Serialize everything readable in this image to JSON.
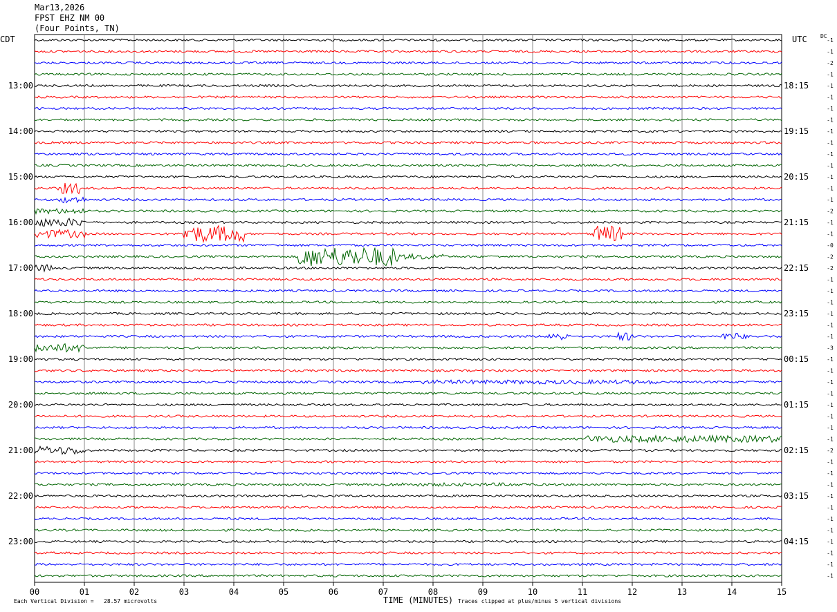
{
  "header": {
    "date": "Mar13,2026",
    "station": "FPST EHZ NM 00",
    "location": "(Four Points, TN)"
  },
  "chart_data": {
    "type": "line",
    "plot_kind": "helicorder",
    "left_timezone": "CDT",
    "right_timezone": "UTC",
    "dc_label": "DC",
    "left_hour_labels": [
      "13:00",
      "14:00",
      "15:00",
      "16:00",
      "17:00",
      "18:00",
      "19:00",
      "20:00",
      "21:00",
      "22:00",
      "23:00"
    ],
    "right_hour_labels": [
      "18:15",
      "19:15",
      "20:15",
      "21:15",
      "22:15",
      "23:15",
      "00:15",
      "01:15",
      "02:15",
      "03:15",
      "04:15"
    ],
    "x_tick_labels": [
      "00",
      "01",
      "02",
      "03",
      "04",
      "05",
      "06",
      "07",
      "08",
      "09",
      "10",
      "11",
      "12",
      "13",
      "14",
      "15"
    ],
    "xlim": [
      0,
      15
    ],
    "xlabel": "TIME (MINUTES)",
    "trace_colors": [
      "#000000",
      "#ff0000",
      "#0000ff",
      "#006400"
    ],
    "dc_offsets": [
      "-1",
      "-1",
      "-2",
      "-1",
      "-1",
      "-1",
      "-1",
      "-1",
      "-1",
      "-1",
      "-1",
      "-1",
      "-1",
      "-1",
      "-1",
      "-2",
      "-1",
      "-1",
      "-0",
      "-2",
      "-2",
      "-1",
      "-1",
      "-1",
      "-1",
      "-1",
      "-1",
      "-3",
      "-1",
      "-1",
      "-1",
      "-1",
      "-1",
      "-1",
      "-1",
      "-1",
      "-2",
      "-1",
      "-1",
      "-1",
      "-1",
      "-1",
      "-1",
      "-1",
      "-1",
      "-1",
      "-1",
      "-1"
    ],
    "trace_count": 48,
    "minutes_per_line": 15,
    "footer_left": "Each Vertical Division =   28.57 microvolts",
    "footer_right": "Traces clipped at plus/minus 5 vertical divisions"
  }
}
